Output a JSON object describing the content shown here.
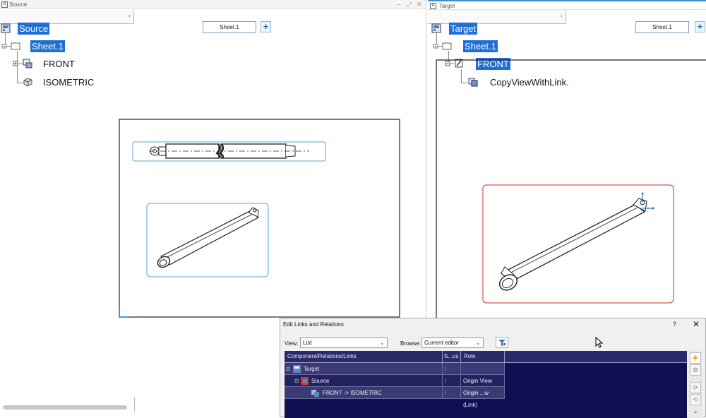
{
  "source_window": {
    "title": "Source",
    "sheet_tab": "Sheet.1",
    "tree": {
      "root": "Source",
      "sheet": "Sheet.1",
      "views": [
        "FRONT",
        "ISOMETRIC"
      ]
    }
  },
  "target_window": {
    "title": "Target",
    "sheet_tab": "Sheet.1",
    "tree": {
      "root": "Target",
      "sheet": "Sheet.1",
      "view": "FRONT",
      "link": "CopyViewWithLink."
    }
  },
  "dialog": {
    "title": "Edit Links and Relations",
    "help": "?",
    "close": "✕",
    "view_label": "View:",
    "view_value": "List",
    "browse_label": "Browse:",
    "browse_value": "Current editor",
    "columns": [
      "Component/Relations/Links",
      "S...us",
      "Role"
    ],
    "rows": [
      {
        "name": "Target",
        "role": ""
      },
      {
        "name": "Source",
        "role": "Origin View"
      },
      {
        "name": "FRONT -> ISOMETRIC",
        "role": "Origin ...w (Link)"
      }
    ]
  },
  "colors": {
    "selection": "#1e6fd8",
    "grid_bg": "#0f0f52",
    "accent_blue": "#3f8fd2",
    "frame_red": "#cc2a2a"
  }
}
